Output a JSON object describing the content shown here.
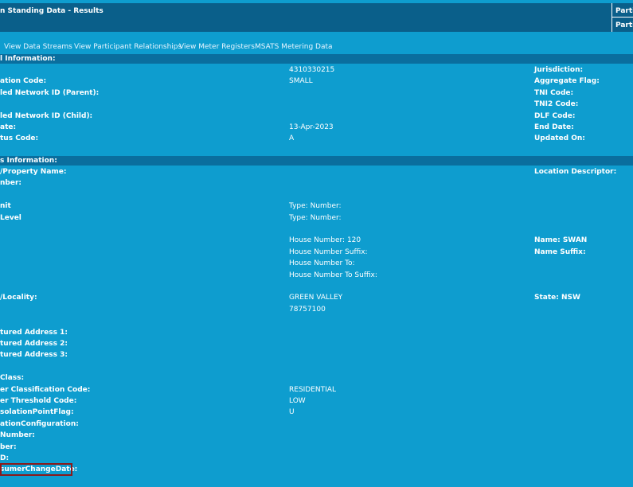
{
  "header": {
    "title": "n Standing Data - Results",
    "right_labels": [
      "Partic",
      "Partic"
    ]
  },
  "nav": {
    "links": [
      "View Data Streams",
      "View Participant Relationships",
      "View Meter Registers",
      "MSATS Metering Data"
    ]
  },
  "general": {
    "section_title": "l Information:",
    "rows": [
      {
        "c1": "",
        "c2": "4310330215",
        "c3": "Jurisdiction:"
      },
      {
        "c1": "ation Code:",
        "c2": "SMALL",
        "c3": "Aggregate Flag:"
      },
      {
        "c1": "led Network ID (Parent):",
        "c2": "",
        "c3": "TNI Code:"
      },
      {
        "c1": "",
        "c2": "",
        "c3": "TNI2 Code:"
      },
      {
        "c1": "led Network ID (Child):",
        "c2": "",
        "c3": "DLF Code:"
      },
      {
        "c1": "ate:",
        "c2": "13-Apr-2023",
        "c3": "End Date:"
      },
      {
        "c1": "tus Code:",
        "c2": "A",
        "c3": "Updated On:"
      }
    ]
  },
  "address": {
    "section_title": "s Information:",
    "rows": [
      {
        "c1": "/Property Name:",
        "c2": "",
        "c3": "Location Descriptor:"
      },
      {
        "c1": "nber:",
        "c2": "",
        "c3": ""
      },
      {
        "c1": "",
        "c2": "",
        "c3": ""
      },
      {
        "c1": "nit",
        "c2": "Type:    Number:",
        "c3": ""
      },
      {
        "c1": "Level",
        "c2": "Type:    Number:",
        "c3": ""
      },
      {
        "c1": "",
        "c2": "",
        "c3": ""
      },
      {
        "c1": "",
        "c2": "House Number: 120",
        "c3": "Name: SWAN"
      },
      {
        "c1": "",
        "c2": "House Number Suffix:",
        "c3": "Name Suffix:"
      },
      {
        "c1": "",
        "c2": "House Number To:",
        "c3": ""
      },
      {
        "c1": "",
        "c2": "House Number To Suffix:",
        "c3": ""
      },
      {
        "c1": "",
        "c2": "",
        "c3": ""
      },
      {
        "c1": "/Locality:",
        "c2": "GREEN VALLEY",
        "c3": "State: NSW"
      },
      {
        "c1": "",
        "c2": "78757100",
        "c3": ""
      },
      {
        "c1": "",
        "c2": "",
        "c3": ""
      },
      {
        "c1": "tured Address 1:",
        "c2": "",
        "c3": ""
      },
      {
        "c1": "tured Address 2:",
        "c2": "",
        "c3": ""
      },
      {
        "c1": "tured Address 3:",
        "c2": "",
        "c3": ""
      },
      {
        "c1": "",
        "c2": "",
        "c3": ""
      },
      {
        "c1": "Class:",
        "c2": "",
        "c3": ""
      },
      {
        "c1": "er Classification Code:",
        "c2": "RESIDENTIAL",
        "c3": ""
      },
      {
        "c1": "er Threshold Code:",
        "c2": "LOW",
        "c3": ""
      },
      {
        "c1": "solationPointFlag:",
        "c2": "U",
        "c3": ""
      },
      {
        "c1": "ationConfiguration:",
        "c2": "",
        "c3": ""
      },
      {
        "c1": "Number:",
        "c2": "",
        "c3": ""
      },
      {
        "c1": "ber:",
        "c2": "",
        "c3": ""
      },
      {
        "c1": "D:",
        "c2": "",
        "c3": ""
      },
      {
        "c1": "sumerChangeDate:",
        "c2": "",
        "c3": ""
      }
    ]
  },
  "colors": {
    "background": "#0e9dcf",
    "titlebar": "#0a5f8a",
    "section": "#0a6e9e",
    "highlight": "#8b1a1a"
  }
}
